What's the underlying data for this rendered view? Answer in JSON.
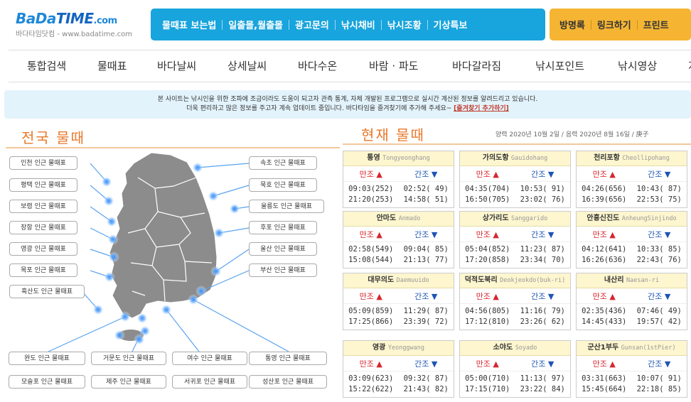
{
  "logo": {
    "brand_bada": "BaDa",
    "brand_time": "TIME",
    "brand_com": ".com",
    "sub": "바다타임닷컴 - www.badatime.com"
  },
  "topnav": [
    "물때표 보는법",
    "일출몰,월출몰",
    "광고문의",
    "낚시채비",
    "낚시조황",
    "기상특보"
  ],
  "topnav2": [
    "방명록",
    "링크하기",
    "프린트"
  ],
  "mainnav": [
    "통합검색",
    "물때표",
    "바다날씨",
    "상세날씨",
    "바다수온",
    "바람 · 파도",
    "바다갈라짐",
    "낚시포인트",
    "낚시영상",
    "지"
  ],
  "notice": {
    "line1": "본 사이트는 낚시인을 위한 조파에 조금이라도 도움이 되고자 관측 통계, 자체 개발된 프로그램으로 실시간 계산된 정보를 알려드리고 있습니다.",
    "line2": "더욱 편리하고 많은 정보를 주고자 계속 업데이트 중입니다. 바다타임을 즐겨찾기에 추가해 주세요~",
    "link": "[즐겨찾기 추가하기]"
  },
  "left_title": "전국 물때",
  "right_title": "현재 물때",
  "dateinfo": "양력 2020년 10월 2일 / 음력 2020년 8월 16일 / 庚子",
  "map_pills_left": [
    "인천 인근 물때표",
    "평택 인근 물때표",
    "보령 인근 물때표",
    "장항 인근 물때표",
    "영광 인근 물때표",
    "목포 인근 물때표",
    "흑산도 인근 물때표"
  ],
  "map_pills_right": [
    "속초 인근 물때표",
    "묵호 인근 물때표",
    "울릉도 인근 물때표",
    "후포 인근 물때표",
    "울산 인근 물때표",
    "부산 인근 물때표"
  ],
  "map_pills_bottom1": [
    "완도 인근 물때표",
    "거문도 인근 물때표",
    "여수 인근 물때표",
    "통영 인근 물때표"
  ],
  "map_pills_bottom2": [
    "모슬포 인근 물때표",
    "제주 인근 물때표",
    "서귀포 인근 물때표",
    "성산포 인근 물때표"
  ],
  "labels": {
    "high": "만조",
    "low": "간조",
    "up": "▲",
    "down": "▼"
  },
  "cards": [
    {
      "ko": "통영",
      "en": "Tongyeonghang",
      "h1": "09:03(252)",
      "l1": "02:52( 49)",
      "h2": "21:20(253)",
      "l2": "14:58( 51)"
    },
    {
      "ko": "가의도항",
      "en": "Gauidohang",
      "h1": "04:35(704)",
      "l1": "10:53( 91)",
      "h2": "16:50(705)",
      "l2": "23:02( 76)"
    },
    {
      "ko": "천리포항",
      "en": "Cheollipohang",
      "h1": "04:26(656)",
      "l1": "10:43( 87)",
      "h2": "16:39(656)",
      "l2": "22:53( 75)"
    },
    {
      "ko": "안마도",
      "en": "Anmado",
      "h1": "02:58(549)",
      "l1": "09:04( 85)",
      "h2": "15:08(544)",
      "l2": "21:13( 77)"
    },
    {
      "ko": "상가리도",
      "en": "Sanggarido",
      "h1": "05:04(852)",
      "l1": "11:23( 87)",
      "h2": "17:20(858)",
      "l2": "23:34( 70)"
    },
    {
      "ko": "안흥신진도",
      "en": "AnheungSinjindo",
      "h1": "04:12(641)",
      "l1": "10:33( 85)",
      "h2": "16:26(636)",
      "l2": "22:43( 76)"
    },
    {
      "ko": "대무의도",
      "en": "Daemuuido",
      "h1": "05:09(859)",
      "l1": "11:29( 87)",
      "h2": "17:25(866)",
      "l2": "23:39( 72)"
    },
    {
      "ko": "덕적도북리",
      "en": "Deokjeokdo(buk-ri)",
      "h1": "04:56(805)",
      "l1": "11:16( 79)",
      "h2": "17:12(810)",
      "l2": "23:26( 62)"
    },
    {
      "ko": "내산리",
      "en": "Naesan-ri",
      "h1": "02:35(436)",
      "l1": "07:46( 49)",
      "h2": "14:45(433)",
      "l2": "19:57( 42)"
    },
    {
      "ko": "영광",
      "en": "Yeonggwang",
      "h1": "03:09(623)",
      "l1": "09:32( 87)",
      "h2": "15:22(622)",
      "l2": "21:43( 82)"
    },
    {
      "ko": "소야도",
      "en": "Soyado",
      "h1": "05:00(710)",
      "l1": "11:13( 97)",
      "h2": "17:15(710)",
      "l2": "23:22( 84)"
    },
    {
      "ko": "군산1부두",
      "en": "Gunsan(1stPier)",
      "h1": "03:31(663)",
      "l1": "10:07( 91)",
      "h2": "15:45(664)",
      "l2": "22:18( 85)"
    }
  ],
  "colors": {
    "topnav": "#18a4dc",
    "topnav2": "#f5b533",
    "title": "#e8792b",
    "high": "#d7262e",
    "low": "#1e55b4",
    "cardhead": "#fdf6cf"
  }
}
